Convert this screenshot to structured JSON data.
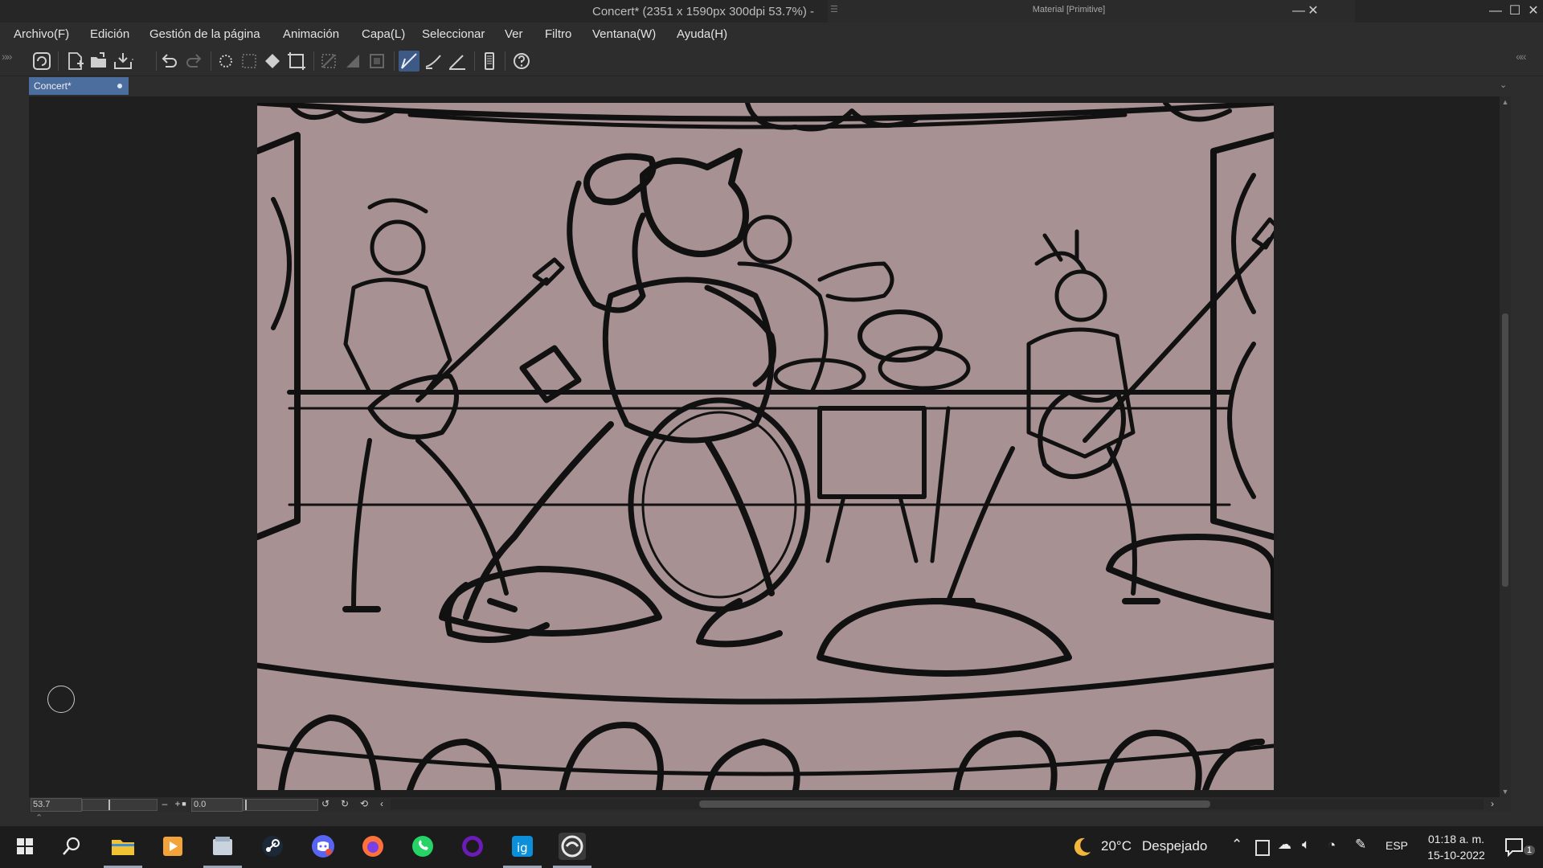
{
  "window": {
    "title": "Concert* (2351 x 1590px 300dpi 53.7%)  -",
    "panel_title": "Material [Primitive]",
    "minimize": "—",
    "maximize": "☐",
    "close": "✕",
    "panel_minimize": "—",
    "panel_close": "✕"
  },
  "menu": {
    "items": [
      "Archivo(F)",
      "Edición",
      "Gestión de la página",
      "Animación",
      "Capa(L)",
      "Seleccionar",
      "Ver",
      "Filtro",
      "Ventana(W)",
      "Ayuda(H)"
    ]
  },
  "toolbar": {
    "icons": [
      "clip-studio-icon",
      "new-file-icon",
      "open-file-icon",
      "save-icon",
      "undo-icon",
      "redo-icon",
      "clear-icon",
      "clear-outside-icon",
      "fill-icon",
      "transform-icon",
      "hide-selection-icon",
      "fill-selection-icon",
      "stroke-selection-icon",
      "ruler-snap-icon",
      "special-ruler-snap-icon",
      "grid-snap-icon",
      "smartphone-icon",
      "help-icon"
    ],
    "left_arrows": "»»",
    "right_arrows": "««"
  },
  "tab": {
    "label": "Concert*"
  },
  "status": {
    "zoom": "53.7",
    "rotation": "0.0",
    "zoom_out": "–",
    "zoom_in": "+",
    "stop": "■"
  },
  "taskbar": {
    "weather_temp": "20°C",
    "weather_desc": "Despejado",
    "language": "ESP",
    "time": "01:18 a. m.",
    "date": "15-10-2022",
    "notification_count": "1",
    "apps": [
      "windows-start-icon",
      "search-icon",
      "file-explorer-icon",
      "media-player-icon",
      "files-app-icon",
      "steam-icon",
      "discord-icon",
      "firefox-icon",
      "whatsapp-icon",
      "obs-icon",
      "instagram-icon",
      "clip-studio-taskbar-icon"
    ]
  },
  "colors": {
    "canvas": "#a79193",
    "accent": "#4b6e9e",
    "background": "#2d2d2d",
    "workspace": "#1f1f1f"
  }
}
